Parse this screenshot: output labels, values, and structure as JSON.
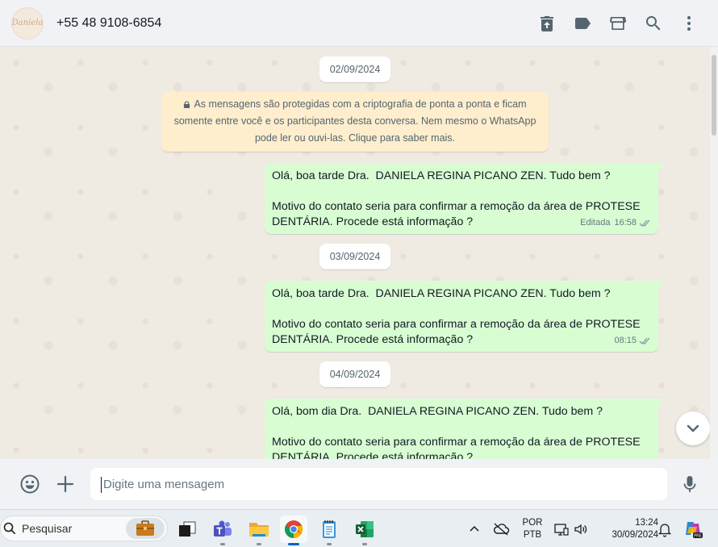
{
  "header": {
    "contact_name": "+55 48 9108-6854",
    "avatar_text": "Daniela",
    "icons": [
      "delete-icon",
      "label-icon",
      "store-icon",
      "search-icon",
      "menu-dots-icon"
    ]
  },
  "chat": {
    "dates": [
      "02/09/2024",
      "03/09/2024",
      "04/09/2024"
    ],
    "encryption_notice": {
      "line1": "As mensagens são protegidas com a criptografia de ponta a ponta e ficam",
      "line2": "somente entre você e os participantes desta conversa. Nem mesmo o WhatsApp",
      "line3": "pode ler ou ouvi-las. Clique para saber mais."
    },
    "messages": [
      {
        "line1": "Olá, boa tarde Dra.  DANIELA REGINA PICANO ZEN. Tudo bem ?",
        "line2": "Motivo do contato seria para confirmar a remoção da área de PROTESE",
        "line3": "DENTÁRIA. Procede está informação ?",
        "edited": "Editada",
        "time": "16:58"
      },
      {
        "line1": "Olá, boa tarde Dra.  DANIELA REGINA PICANO ZEN. Tudo bem ?",
        "line2": "Motivo do contato seria para confirmar a remoção da área de PROTESE",
        "line3": "DENTÁRIA. Procede está informação ?",
        "time": "08:15"
      },
      {
        "line1": "Olá, bom dia Dra.  DANIELA REGINA PICANO ZEN. Tudo bem ?",
        "line2": "Motivo do contato seria para confirmar a remoção da área de PROTESE",
        "line3": "DENTÁRIA. Procede está informação ?"
      }
    ]
  },
  "composer": {
    "placeholder": "Digite uma mensagem"
  },
  "taskbar": {
    "search_label": "Pesquisar",
    "language_line1": "POR",
    "language_line2": "PTB",
    "time": "13:24",
    "date": "30/09/2024"
  },
  "colors": {
    "outgoing_bubble": "#d9fdd3",
    "chat_background": "#efeae2",
    "header_background": "#f0f2f5",
    "encryption_notice": "#ffeecd",
    "tick_read": "#53bdeb",
    "tick_delivered": "#8696a0"
  }
}
